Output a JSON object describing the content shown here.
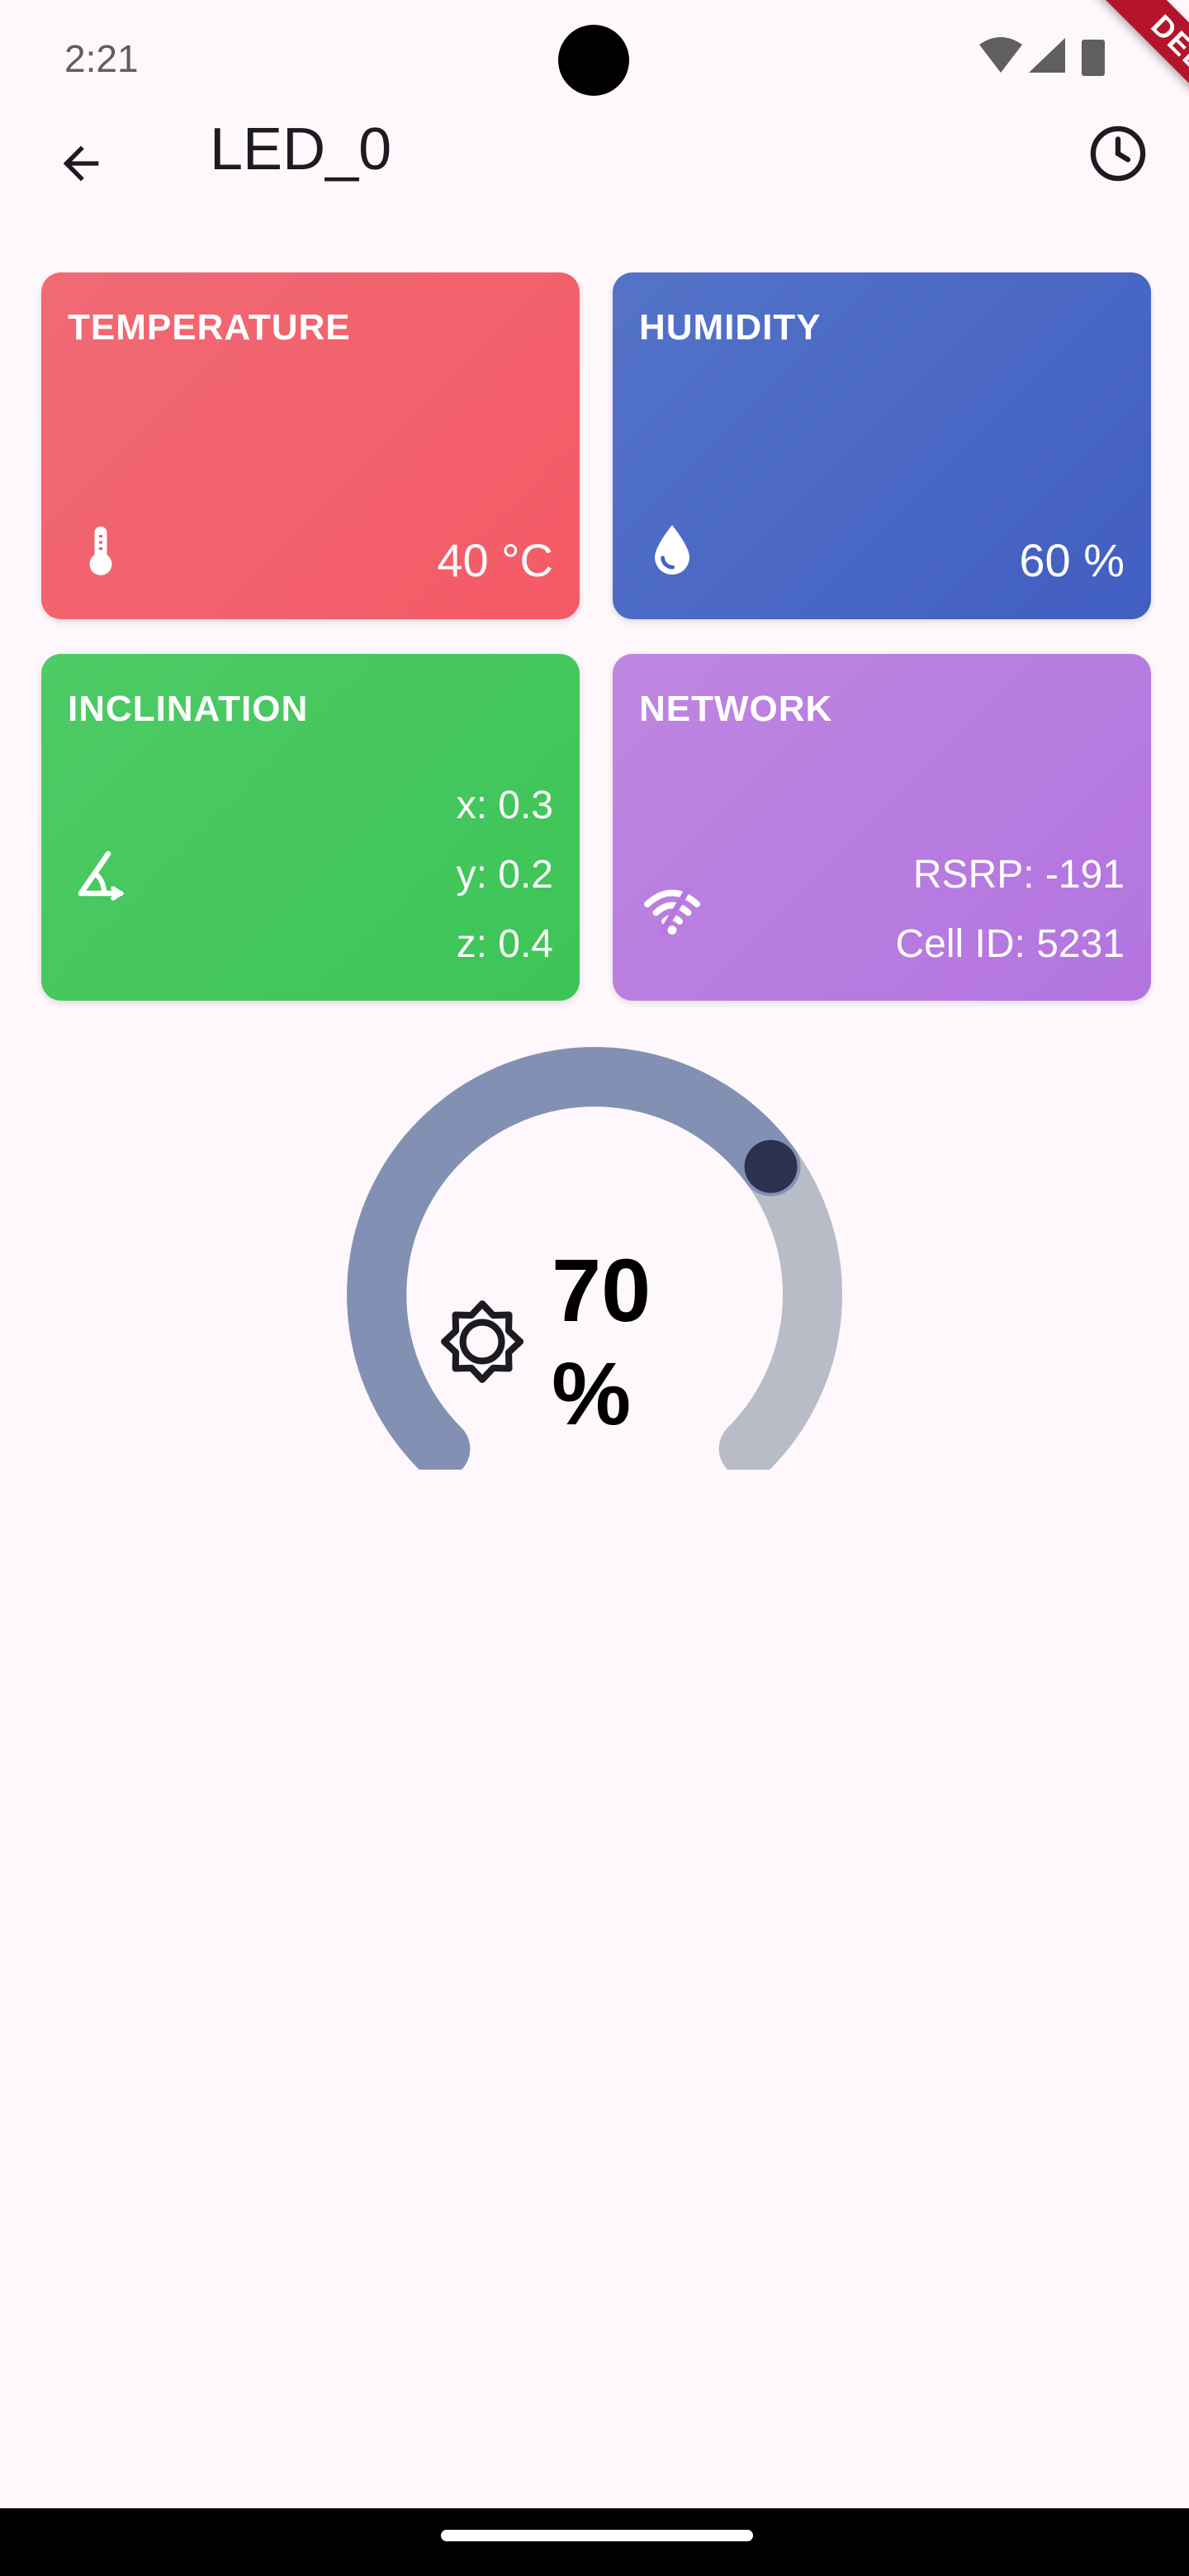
{
  "status_bar": {
    "time": "2:21",
    "icons": [
      "wifi-icon",
      "cell-signal-icon",
      "battery-icon"
    ]
  },
  "debug_banner": "DEBUG",
  "app_bar": {
    "title": "LED_0",
    "back_icon": "arrow-back-icon",
    "history_icon": "clock-icon"
  },
  "cards": {
    "temperature": {
      "title": "TEMPERATURE",
      "value": "40 °C",
      "icon": "thermometer-icon",
      "color": "#f45a66"
    },
    "humidity": {
      "title": "HUMIDITY",
      "value": "60 %",
      "icon": "water-drop-icon",
      "color": "#4361c2"
    },
    "inclination": {
      "title": "INCLINATION",
      "x": "x: 0.3",
      "y": "y: 0.2",
      "z": "z: 0.4",
      "icon": "inclination-angle-icon",
      "color": "#43c75a"
    },
    "network": {
      "title": "NETWORK",
      "rsrp": "RSRP: -191",
      "cell_id": "Cell ID: 5231",
      "icon": "wifi-icon",
      "color": "#b777e0"
    }
  },
  "brightness": {
    "value_text": "70 %",
    "level": 0.7,
    "icon": "brightness-icon",
    "active_color": "#8190b3",
    "inactive_color": "#b7bcc6",
    "thumb_color": "#2c3150"
  }
}
